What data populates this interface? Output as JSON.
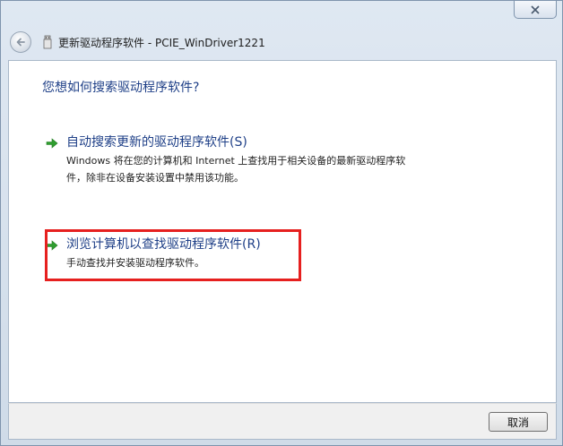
{
  "window": {
    "title": "更新驱动程序软件 - PCIE_WinDriver1221",
    "close_label": "✕"
  },
  "main": {
    "question": "您想如何搜索驱动程序软件?",
    "options": [
      {
        "title": "自动搜索更新的驱动程序软件(S)",
        "description_line1": "Windows 将在您的计算机和 Internet 上查找用于相关设备的最新驱动程序软",
        "description_line2": "件，除非在设备安装设置中禁用该功能。"
      },
      {
        "title": "浏览计算机以查找驱动程序软件(R)",
        "description_line1": "手动查找并安装驱动程序软件。"
      }
    ]
  },
  "footer": {
    "cancel_label": "取消"
  },
  "colors": {
    "accent_text": "#1e3f87",
    "highlight_box": "#e6201f",
    "arrow_green": "#2f9e2f"
  },
  "icons": {
    "back": "back-arrow-icon",
    "device": "usb-device-icon",
    "option_arrow": "green-arrow-icon",
    "close": "close-icon"
  }
}
